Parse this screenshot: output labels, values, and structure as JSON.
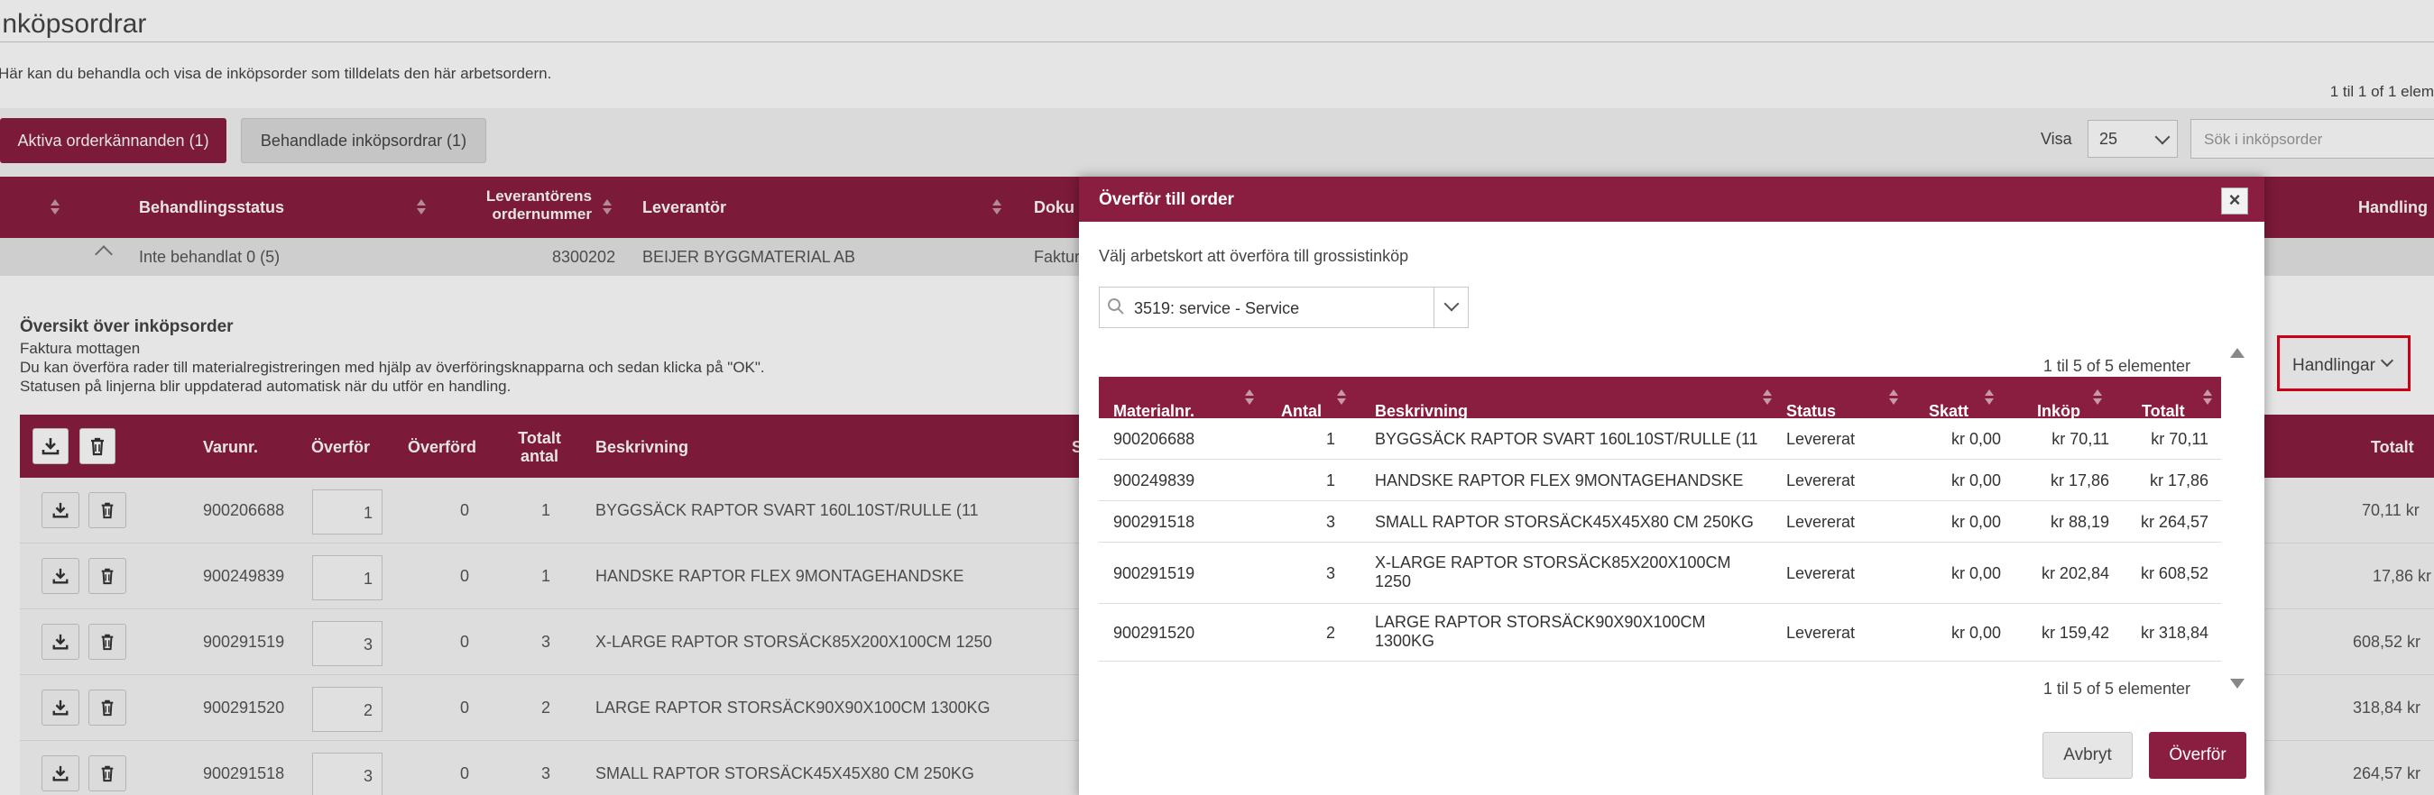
{
  "page": {
    "title": "Inköpsordrar",
    "subtitle": "Här kan du behandla och visa de inköpsorder som tilldelats den här arbetsordern.",
    "count_text": "1 til 1 of 1 elem",
    "tabs": [
      {
        "label": "Aktiva orderkännanden (1)",
        "active": true
      },
      {
        "label": "Behandlade inköpsordrar (1)",
        "active": false
      }
    ],
    "visa_label": "Visa",
    "visa_value": "25",
    "search_placeholder": "Sök i inköpsorder"
  },
  "main_table": {
    "headers": {
      "status": "Behandlingsstatus",
      "order_no": "Leverantörens ordernummer",
      "supplier": "Leverantör",
      "doc": "Doku",
      "actions": "Handling"
    },
    "row": {
      "status": "Inte behandlat 0 (5)",
      "order_no": "8300202",
      "supplier": "BEIJER BYGGMATERIAL AB",
      "doc": "Faktura"
    }
  },
  "overview": {
    "title": "Översikt över inköpsorder",
    "lines": [
      "Faktura mottagen",
      "Du kan överföra rader till materialregistreringen med hjälp av överföringsknapparna och sedan klicka på \"OK\".",
      "Statusen på linjerna blir uppdaterad automatisk när du utför en handling."
    ],
    "actions_button": "Handlingar"
  },
  "sub_table": {
    "headers": {
      "item_no": "Varunr.",
      "transfer": "Överför",
      "transferred": "Överförd",
      "total_qty": "Totalt antal",
      "desc": "Beskrivning",
      "s": "S",
      "total": "Totalt"
    },
    "rows": [
      {
        "item_no": "900206688",
        "transfer": "1",
        "transferred": "0",
        "total_qty": "1",
        "desc": "BYGGSÄCK RAPTOR SVART 160L10ST/RULLE (11",
        "total": "70,11 kr"
      },
      {
        "item_no": "900249839",
        "transfer": "1",
        "transferred": "0",
        "total_qty": "1",
        "desc": "HANDSKE RAPTOR FLEX 9MONTAGEHANDSKE",
        "total": "17,86 kr"
      },
      {
        "item_no": "900291519",
        "transfer": "3",
        "transferred": "0",
        "total_qty": "3",
        "desc": "X-LARGE RAPTOR STORSÄCK85X200X100CM 1250",
        "total": "608,52 kr"
      },
      {
        "item_no": "900291520",
        "transfer": "2",
        "transferred": "0",
        "total_qty": "2",
        "desc": "LARGE RAPTOR STORSÄCK90X90X100CM 1300KG",
        "total": "318,84 kr"
      },
      {
        "item_no": "900291518",
        "transfer": "3",
        "transferred": "0",
        "total_qty": "3",
        "desc": "SMALL RAPTOR STORSÄCK45X45X80 CM 250KG",
        "total": "264,57 kr"
      }
    ]
  },
  "modal": {
    "title": "Överför till order",
    "instruction": "Välj arbetskort att överföra till grossistinköp",
    "selected_workcard": "3519: service - Service",
    "count_text": "1 til 5 of 5 elementer",
    "headers": {
      "item_no": "Materialnr.",
      "qty": "Antal",
      "desc": "Beskrivning",
      "status": "Status",
      "tax": "Skatt",
      "purchase": "Inköp",
      "total": "Totalt"
    },
    "rows": [
      {
        "item_no": "900206688",
        "qty": "1",
        "desc": "BYGGSÄCK RAPTOR SVART 160L10ST/RULLE (11",
        "status": "Levererat",
        "tax": "kr 0,00",
        "purchase": "kr 70,11",
        "total": "kr 70,11"
      },
      {
        "item_no": "900249839",
        "qty": "1",
        "desc": "HANDSKE RAPTOR FLEX 9MONTAGEHANDSKE",
        "status": "Levererat",
        "tax": "kr 0,00",
        "purchase": "kr 17,86",
        "total": "kr 17,86"
      },
      {
        "item_no": "900291518",
        "qty": "3",
        "desc": "SMALL RAPTOR STORSÄCK45X45X80 CM 250KG",
        "status": "Levererat",
        "tax": "kr 0,00",
        "purchase": "kr 88,19",
        "total": "kr 264,57"
      },
      {
        "item_no": "900291519",
        "qty": "3",
        "desc": "X-LARGE RAPTOR STORSÄCK85X200X100CM 1250",
        "status": "Levererat",
        "tax": "kr 0,00",
        "purchase": "kr 202,84",
        "total": "kr 608,52"
      },
      {
        "item_no": "900291520",
        "qty": "2",
        "desc": "LARGE RAPTOR STORSÄCK90X90X100CM 1300KG",
        "status": "Levererat",
        "tax": "kr 0,00",
        "purchase": "kr 159,42",
        "total": "kr 318,84"
      }
    ],
    "cancel_label": "Avbryt",
    "ok_label": "Överför"
  }
}
